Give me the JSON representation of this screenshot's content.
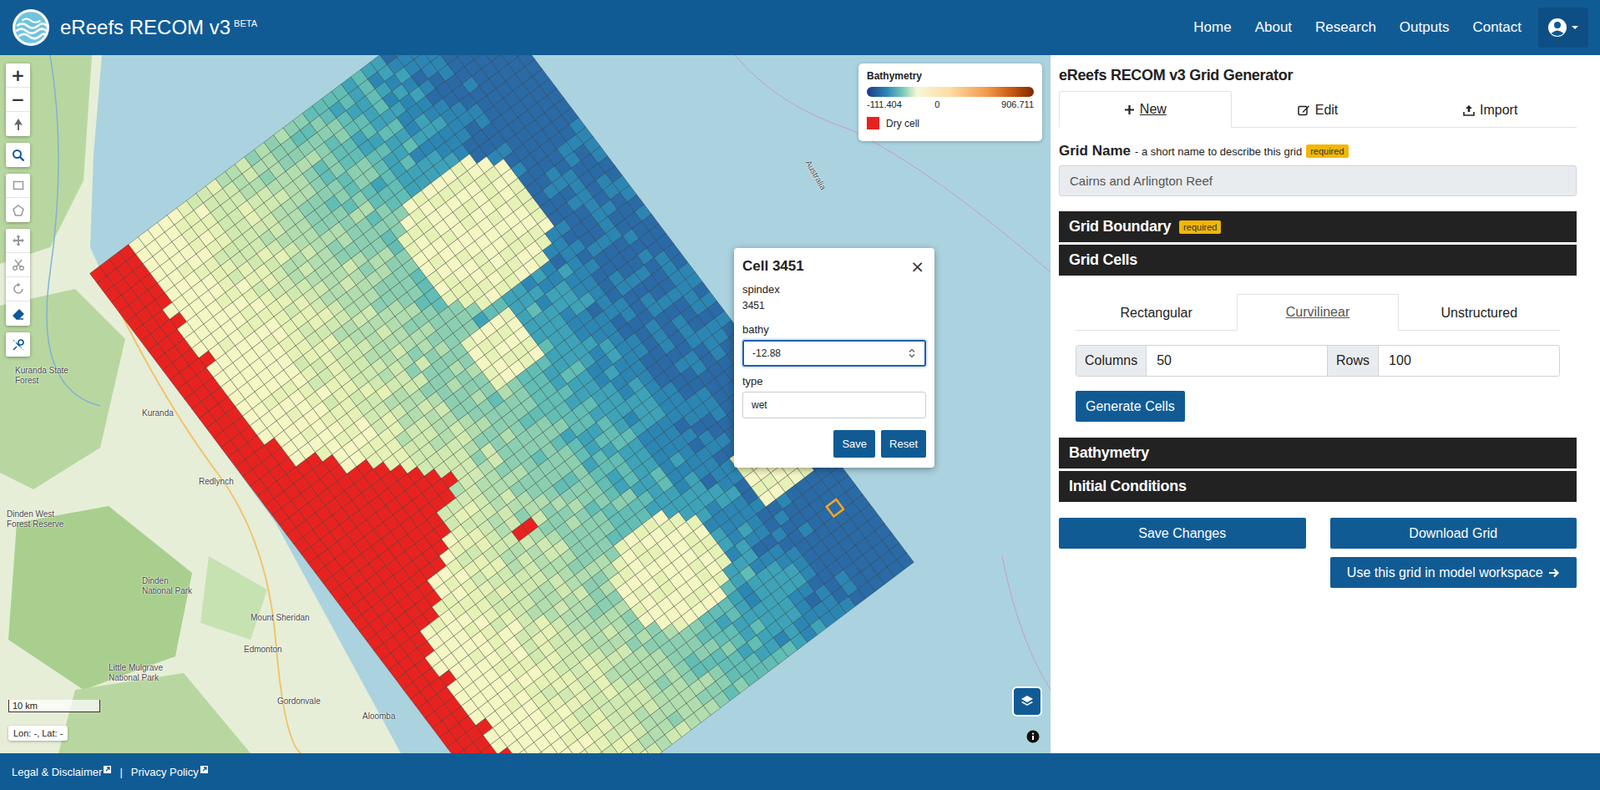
{
  "header": {
    "title": "eReefs RECOM v3",
    "badge": "BETA",
    "nav": [
      {
        "label": "Home"
      },
      {
        "label": "About"
      },
      {
        "label": "Research"
      },
      {
        "label": "Outputs"
      },
      {
        "label": "Contact"
      }
    ]
  },
  "map": {
    "zoom_in": "+",
    "zoom_out": "−",
    "labels": [
      "Kuranda State Forest",
      "Kuranda",
      "Redlynch",
      "Dinden West Forest Reserve",
      "Dinden National Park",
      "Mount Sheridan",
      "Edmonton",
      "Little Mulgrave National Park",
      "Gordonvale",
      "Aloomba",
      "Australia"
    ],
    "legend": {
      "title": "Bathymetry",
      "min": "-111.404",
      "zero": "0",
      "max": "906.711",
      "dry_label": "Dry cell"
    },
    "scale": "10 km",
    "coords": "Lon: -, Lat: -",
    "popup": {
      "open": true,
      "title": "Cell 3451",
      "close": "×",
      "fields": [
        {
          "label": "spindex",
          "kind": "static",
          "value": "3451",
          "focused": false
        },
        {
          "label": "bathy",
          "kind": "number",
          "value": "-12.88",
          "focused": true
        },
        {
          "label": "type",
          "kind": "text",
          "value": "wet",
          "focused": false
        }
      ],
      "buttons": [
        "Save",
        "Reset"
      ]
    }
  },
  "panel": {
    "title": "eReefs RECOM v3 Grid Generator",
    "tabs": [
      {
        "label": "New",
        "selected": true
      },
      {
        "label": "Edit",
        "selected": false
      },
      {
        "label": "Import",
        "selected": false
      }
    ],
    "grid_name": {
      "label": "Grid Name",
      "hint": "- a short name to describe this grid",
      "badge": "required",
      "value": "Cairns and Arlington Reef"
    },
    "sections": [
      {
        "title": "Grid Boundary",
        "badge": "required",
        "expanded": false
      },
      {
        "title": "Grid Cells",
        "badge": "",
        "expanded": true
      },
      {
        "title": "Bathymetry",
        "badge": "",
        "expanded": false
      },
      {
        "title": "Initial Conditions",
        "badge": "",
        "expanded": false
      }
    ],
    "grid_types": [
      {
        "label": "Rectangular",
        "selected": false
      },
      {
        "label": "Curvilinear",
        "selected": true
      },
      {
        "label": "Unstructured",
        "selected": false
      }
    ],
    "dims": [
      {
        "label": "Columns",
        "value": "50"
      },
      {
        "label": "Rows",
        "value": "100"
      }
    ],
    "generate": "Generate Cells",
    "actions": [
      "Save Changes",
      "Download Grid",
      "Use this grid in model workspace"
    ]
  },
  "footer": {
    "links": [
      "Legal & Disclaimer",
      "Privacy Policy"
    ],
    "separator": "|"
  }
}
